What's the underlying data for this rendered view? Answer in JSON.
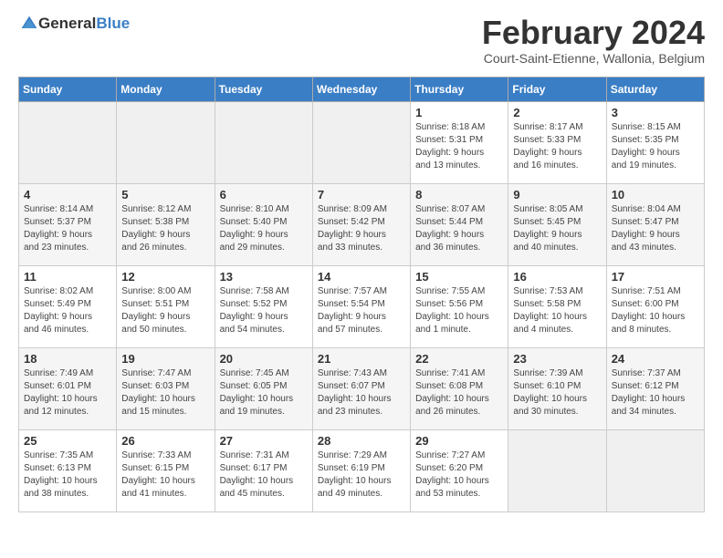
{
  "logo": {
    "general": "General",
    "blue": "Blue"
  },
  "header": {
    "month": "February 2024",
    "location": "Court-Saint-Etienne, Wallonia, Belgium"
  },
  "days_of_week": [
    "Sunday",
    "Monday",
    "Tuesday",
    "Wednesday",
    "Thursday",
    "Friday",
    "Saturday"
  ],
  "weeks": [
    [
      {
        "day": "",
        "info": ""
      },
      {
        "day": "",
        "info": ""
      },
      {
        "day": "",
        "info": ""
      },
      {
        "day": "",
        "info": ""
      },
      {
        "day": "1",
        "info": "Sunrise: 8:18 AM\nSunset: 5:31 PM\nDaylight: 9 hours\nand 13 minutes."
      },
      {
        "day": "2",
        "info": "Sunrise: 8:17 AM\nSunset: 5:33 PM\nDaylight: 9 hours\nand 16 minutes."
      },
      {
        "day": "3",
        "info": "Sunrise: 8:15 AM\nSunset: 5:35 PM\nDaylight: 9 hours\nand 19 minutes."
      }
    ],
    [
      {
        "day": "4",
        "info": "Sunrise: 8:14 AM\nSunset: 5:37 PM\nDaylight: 9 hours\nand 23 minutes."
      },
      {
        "day": "5",
        "info": "Sunrise: 8:12 AM\nSunset: 5:38 PM\nDaylight: 9 hours\nand 26 minutes."
      },
      {
        "day": "6",
        "info": "Sunrise: 8:10 AM\nSunset: 5:40 PM\nDaylight: 9 hours\nand 29 minutes."
      },
      {
        "day": "7",
        "info": "Sunrise: 8:09 AM\nSunset: 5:42 PM\nDaylight: 9 hours\nand 33 minutes."
      },
      {
        "day": "8",
        "info": "Sunrise: 8:07 AM\nSunset: 5:44 PM\nDaylight: 9 hours\nand 36 minutes."
      },
      {
        "day": "9",
        "info": "Sunrise: 8:05 AM\nSunset: 5:45 PM\nDaylight: 9 hours\nand 40 minutes."
      },
      {
        "day": "10",
        "info": "Sunrise: 8:04 AM\nSunset: 5:47 PM\nDaylight: 9 hours\nand 43 minutes."
      }
    ],
    [
      {
        "day": "11",
        "info": "Sunrise: 8:02 AM\nSunset: 5:49 PM\nDaylight: 9 hours\nand 46 minutes."
      },
      {
        "day": "12",
        "info": "Sunrise: 8:00 AM\nSunset: 5:51 PM\nDaylight: 9 hours\nand 50 minutes."
      },
      {
        "day": "13",
        "info": "Sunrise: 7:58 AM\nSunset: 5:52 PM\nDaylight: 9 hours\nand 54 minutes."
      },
      {
        "day": "14",
        "info": "Sunrise: 7:57 AM\nSunset: 5:54 PM\nDaylight: 9 hours\nand 57 minutes."
      },
      {
        "day": "15",
        "info": "Sunrise: 7:55 AM\nSunset: 5:56 PM\nDaylight: 10 hours\nand 1 minute."
      },
      {
        "day": "16",
        "info": "Sunrise: 7:53 AM\nSunset: 5:58 PM\nDaylight: 10 hours\nand 4 minutes."
      },
      {
        "day": "17",
        "info": "Sunrise: 7:51 AM\nSunset: 6:00 PM\nDaylight: 10 hours\nand 8 minutes."
      }
    ],
    [
      {
        "day": "18",
        "info": "Sunrise: 7:49 AM\nSunset: 6:01 PM\nDaylight: 10 hours\nand 12 minutes."
      },
      {
        "day": "19",
        "info": "Sunrise: 7:47 AM\nSunset: 6:03 PM\nDaylight: 10 hours\nand 15 minutes."
      },
      {
        "day": "20",
        "info": "Sunrise: 7:45 AM\nSunset: 6:05 PM\nDaylight: 10 hours\nand 19 minutes."
      },
      {
        "day": "21",
        "info": "Sunrise: 7:43 AM\nSunset: 6:07 PM\nDaylight: 10 hours\nand 23 minutes."
      },
      {
        "day": "22",
        "info": "Sunrise: 7:41 AM\nSunset: 6:08 PM\nDaylight: 10 hours\nand 26 minutes."
      },
      {
        "day": "23",
        "info": "Sunrise: 7:39 AM\nSunset: 6:10 PM\nDaylight: 10 hours\nand 30 minutes."
      },
      {
        "day": "24",
        "info": "Sunrise: 7:37 AM\nSunset: 6:12 PM\nDaylight: 10 hours\nand 34 minutes."
      }
    ],
    [
      {
        "day": "25",
        "info": "Sunrise: 7:35 AM\nSunset: 6:13 PM\nDaylight: 10 hours\nand 38 minutes."
      },
      {
        "day": "26",
        "info": "Sunrise: 7:33 AM\nSunset: 6:15 PM\nDaylight: 10 hours\nand 41 minutes."
      },
      {
        "day": "27",
        "info": "Sunrise: 7:31 AM\nSunset: 6:17 PM\nDaylight: 10 hours\nand 45 minutes."
      },
      {
        "day": "28",
        "info": "Sunrise: 7:29 AM\nSunset: 6:19 PM\nDaylight: 10 hours\nand 49 minutes."
      },
      {
        "day": "29",
        "info": "Sunrise: 7:27 AM\nSunset: 6:20 PM\nDaylight: 10 hours\nand 53 minutes."
      },
      {
        "day": "",
        "info": ""
      },
      {
        "day": "",
        "info": ""
      }
    ]
  ]
}
